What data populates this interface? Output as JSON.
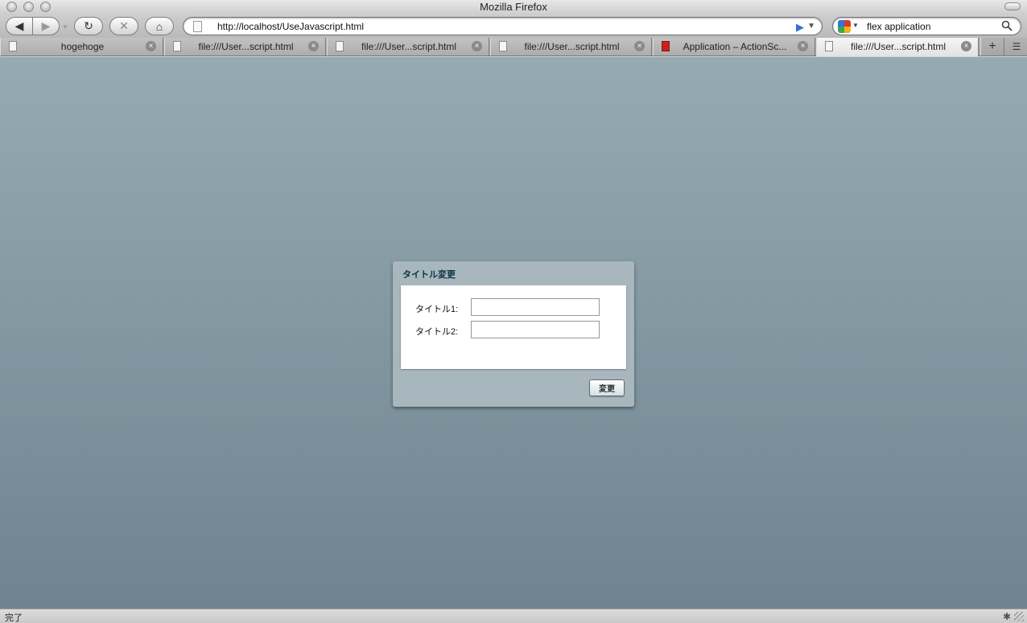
{
  "window": {
    "title": "Mozilla Firefox"
  },
  "toolbar": {
    "url": "http://localhost/UseJavascript.html",
    "search_value": "flex application"
  },
  "tabs": [
    {
      "label": "hogehoge",
      "icon": "page-icon",
      "active": false
    },
    {
      "label": "file:///User...script.html",
      "icon": "page-icon",
      "active": false
    },
    {
      "label": "file:///User...script.html",
      "icon": "page-icon",
      "active": false
    },
    {
      "label": "file:///User...script.html",
      "icon": "page-icon",
      "active": false
    },
    {
      "label": "Application – ActionSc...",
      "icon": "adobe-icon",
      "active": false
    },
    {
      "label": "file:///User...script.html",
      "icon": "page-icon",
      "active": true
    }
  ],
  "panel": {
    "title": "タイトル変更",
    "fields": [
      {
        "label": "タイトル1:",
        "value": ""
      },
      {
        "label": "タイトル2:",
        "value": ""
      }
    ],
    "button_label": "変更"
  },
  "status": {
    "text": "完了"
  },
  "colors": {
    "content_top": "#96aab3",
    "content_bottom": "#6f848f",
    "panel_bg": "#a8b6bd",
    "panel_title": "#0e3340",
    "go_arrow": "#3a6fd8"
  }
}
